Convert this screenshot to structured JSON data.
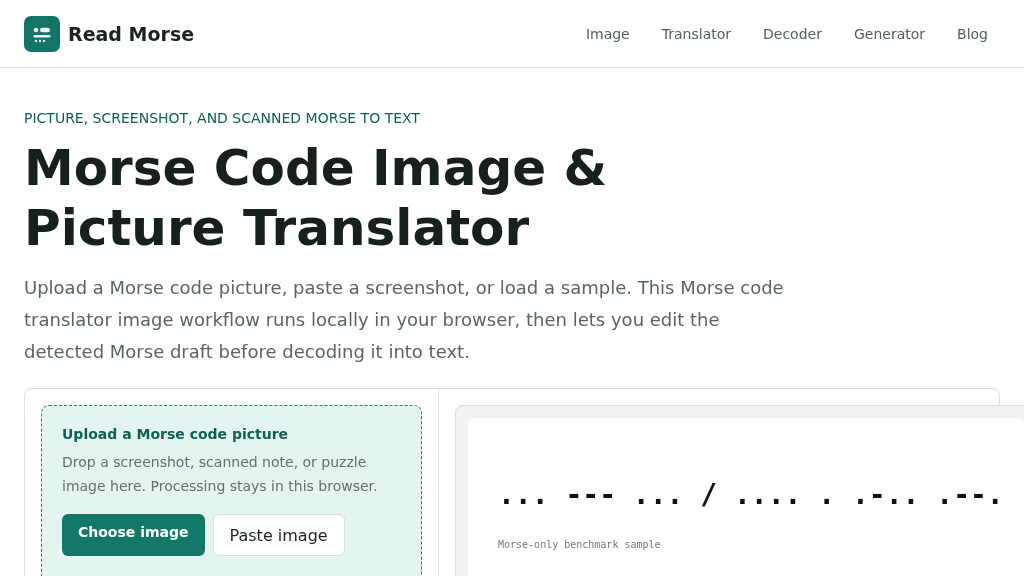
{
  "brand": {
    "name": "Read Morse"
  },
  "nav": [
    "Image",
    "Translator",
    "Decoder",
    "Generator",
    "Blog"
  ],
  "hero": {
    "eyebrow": "PICTURE, SCREENSHOT, AND SCANNED MORSE TO TEXT",
    "title_lines": [
      "Morse Code Image &",
      "Picture Translator"
    ],
    "intro": "Upload a Morse code picture, paste a screenshot, or load a sample. This Morse code translator image workflow runs locally in your browser, then lets you edit the detected Morse draft before decoding it into text."
  },
  "upload": {
    "title": "Upload a Morse code picture",
    "description": "Drop a screenshot, scanned note, or puzzle image here. Processing stays in this browser.",
    "buttons": [
      {
        "label": "Choose image",
        "kind": "primary"
      },
      {
        "label": "Paste image",
        "kind": "secondary"
      }
    ]
  },
  "preview": {
    "morse": "... --- ... / .... . .-.. .--.",
    "caption": "Morse-only benchmark sample"
  }
}
